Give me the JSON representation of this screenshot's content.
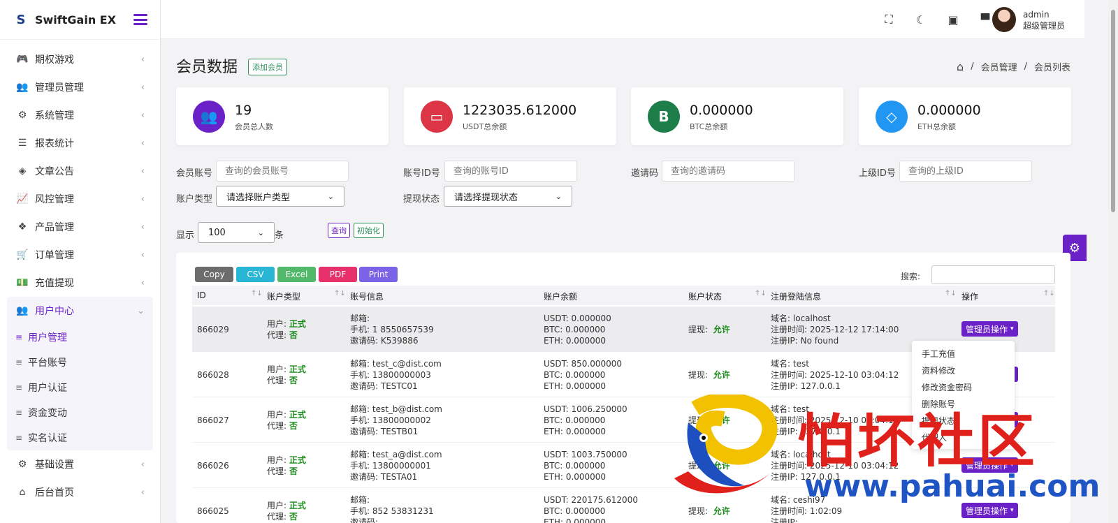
{
  "brand": {
    "name": "SwiftGain EX",
    "logo": "S"
  },
  "sidebar": {
    "items": [
      {
        "label": "期权游戏",
        "icon": "gamepad-icon",
        "glyph": "🎮"
      },
      {
        "label": "管理员管理",
        "icon": "users-icon",
        "glyph": "👥"
      },
      {
        "label": "系统管理",
        "icon": "gear-icon",
        "glyph": "⚙"
      },
      {
        "label": "报表统计",
        "icon": "database-icon",
        "glyph": "☰"
      },
      {
        "label": "文章公告",
        "icon": "layers-icon",
        "glyph": "◈"
      },
      {
        "label": "风控管理",
        "icon": "chart-line-icon",
        "glyph": "📈"
      },
      {
        "label": "产品管理",
        "icon": "cubes-icon",
        "glyph": "❖"
      },
      {
        "label": "订单管理",
        "icon": "cart-icon",
        "glyph": "🛒"
      },
      {
        "label": "充值提现",
        "icon": "money-icon",
        "glyph": "💵"
      }
    ],
    "active_group": {
      "label": "用户中心",
      "icon": "users-icon",
      "glyph": "👥",
      "children": [
        "用户管理",
        "平台账号",
        "用户认证",
        "资金变动",
        "实名认证"
      ]
    },
    "bottom_items": [
      {
        "label": "基础设置",
        "icon": "cogs-icon",
        "glyph": "⚙"
      },
      {
        "label": "后台首页",
        "icon": "home-icon",
        "glyph": "⌂"
      }
    ]
  },
  "topbar": {
    "icons": [
      "fullscreen-icon",
      "moon-icon",
      "money-icon",
      "chat-icon"
    ],
    "user": {
      "name": "admin",
      "role": "超级管理员"
    }
  },
  "page": {
    "title": "会员数据",
    "add_button": "添加会员",
    "breadcrumb": [
      "会员管理",
      "会员列表"
    ]
  },
  "stats": [
    {
      "value": "19",
      "label": "会员总人数",
      "color": "#6b21c8",
      "icon": "users-icon",
      "glyph": "👥"
    },
    {
      "value": "1223035.612000",
      "label": "USDT总余额",
      "color": "#dc3545",
      "icon": "wallet-icon",
      "glyph": "▭"
    },
    {
      "value": "0.000000",
      "label": "BTC总余额",
      "color": "#1e7e4a",
      "icon": "bitcoin-icon",
      "glyph": "B"
    },
    {
      "value": "0.000000",
      "label": "ETH总余额",
      "color": "#2196f3",
      "icon": "diamond-icon",
      "glyph": "◇"
    }
  ],
  "filters": {
    "account_label": "会员账号",
    "account_placeholder": "查询的会员账号",
    "id_label": "账号ID号",
    "id_placeholder": "查询的账号ID",
    "invite_label": "邀请码",
    "invite_placeholder": "查询的邀请码",
    "parent_label": "上级ID号",
    "parent_placeholder": "查询的上级ID",
    "type_label": "账户类型",
    "type_value": "请选择账户类型",
    "withdraw_label": "提现状态",
    "withdraw_value": "请选择提现状态",
    "show_label": "显示",
    "show_value": "100",
    "show_unit": "条",
    "query_btn": "查询",
    "reset_btn": "初始化"
  },
  "export_buttons": [
    {
      "label": "Copy",
      "color": "#6c6c6c"
    },
    {
      "label": "CSV",
      "color": "#29b6d6"
    },
    {
      "label": "Excel",
      "color": "#52b86a"
    },
    {
      "label": "PDF",
      "color": "#e8306a"
    },
    {
      "label": "Print",
      "color": "#7a63e6"
    }
  ],
  "search_label": "搜索:",
  "table": {
    "headers": [
      "ID",
      "账户类型",
      "账号信息",
      "账户余额",
      "账户状态",
      "注册登陆信息",
      "操作"
    ],
    "rows": [
      {
        "id": "866029",
        "user_type": "正式",
        "agent": "否",
        "email": "",
        "phone": "1 8550657539",
        "invite": "K539886",
        "usdt": "0.000000",
        "btc": "0.000000",
        "eth": "0.000000",
        "withdraw": "允许",
        "domain": "localhost",
        "reg_time": "2025-12-12 17:14:00",
        "reg_ip": "No found",
        "op": "管理员操作"
      },
      {
        "id": "866028",
        "user_type": "正式",
        "agent": "否",
        "email": "test_c@dist.com",
        "phone": "13800000003",
        "invite": "TESTC01",
        "usdt": "850.000000",
        "btc": "0.000000",
        "eth": "0.000000",
        "withdraw": "允许",
        "domain": "test",
        "reg_time": "2025-12-10 03:04:12",
        "reg_ip": "127.0.0.1",
        "op": "管理员操作"
      },
      {
        "id": "866027",
        "user_type": "正式",
        "agent": "否",
        "email": "test_b@dist.com",
        "phone": "13800000002",
        "invite": "TESTB01",
        "usdt": "1006.250000",
        "btc": "0.000000",
        "eth": "0.000000",
        "withdraw": "允许",
        "domain": "test",
        "reg_time": "2025-12-10 03:04:12",
        "reg_ip": "127.0.0.1",
        "op": "管理员操作"
      },
      {
        "id": "866026",
        "user_type": "正式",
        "agent": "否",
        "email": "test_a@dist.com",
        "phone": "13800000001",
        "invite": "TESTA01",
        "usdt": "1003.750000",
        "btc": "0.000000",
        "eth": "0.000000",
        "withdraw": "允许",
        "domain": "localhost",
        "reg_time": "2025-12-10 03:04:12",
        "reg_ip": "127.0.0.1",
        "op": "管理员操作"
      },
      {
        "id": "866025",
        "user_type": "正式",
        "agent": "否",
        "email": "",
        "phone": "852 53831231",
        "invite": "",
        "usdt": "220175.612000",
        "btc": "0.000000",
        "eth": "0.000000",
        "withdraw": "允许",
        "domain": "ceshi97",
        "reg_time": "1:02:09",
        "reg_ip": "",
        "op": "管理员操作"
      }
    ],
    "labels": {
      "user": "用户:",
      "agent": "代理:",
      "email": "邮箱:",
      "phone": "手机:",
      "invite": "邀请码:",
      "usdt": "USDT:",
      "btc": "BTC:",
      "eth": "ETH:",
      "withdraw": "提现:",
      "domain": "域名:",
      "reg_time": "注册时间:",
      "reg_ip": "注册IP:"
    }
  },
  "dropdown": [
    "手工充值",
    "资料修改",
    "修改资金密码",
    "删除账号",
    "提现状态",
    "代理人"
  ],
  "watermark": {
    "cn": "怕坏社区",
    "url": "www.pahuai.com"
  }
}
